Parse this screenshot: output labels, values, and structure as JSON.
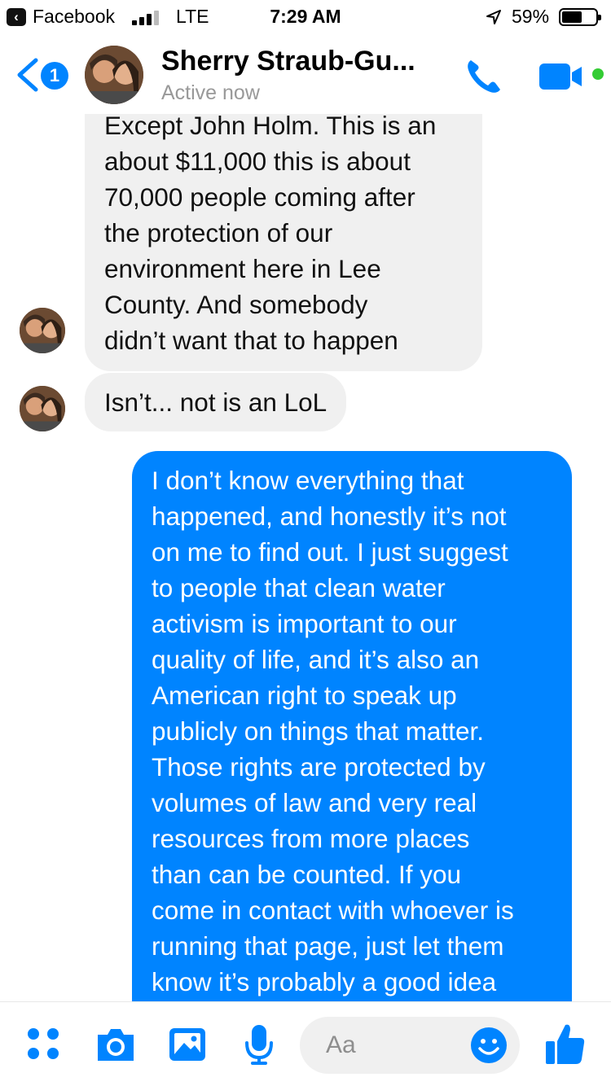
{
  "status_bar": {
    "back_app": "Facebook",
    "network": "LTE",
    "time": "7:29 AM",
    "battery": "59%",
    "battery_level": 0.59
  },
  "header": {
    "unread_count": "1",
    "name": "Sherry Straub-Gu...",
    "status": "Active now"
  },
  "messages": [
    {
      "sender": "contact",
      "text": "Except John Holm. This is an\nabout $11,000 this is about\n70,000 people coming after\nthe protection of our\nenvironment here in Lee\nCounty. And somebody\ndidn’t want that to happen"
    },
    {
      "sender": "contact",
      "text": "Isn’t... not is an LoL"
    },
    {
      "sender": "me",
      "text": "I don’t know everything that\nhappened, and honestly it’s not\non me to find out. I just suggest\nto people that clean water\nactivism is important to our\nquality of life, and it’s also an\nAmerican right to speak up\npublicly on things that matter.\nThose rights are protected by\nvolumes of law and very real\nresources from more places\nthan can be counted. If you\ncome in contact with whoever is\nrunning that page, just let them\nknow it’s probably a good idea"
    }
  ],
  "composer": {
    "placeholder": "Aa"
  },
  "colors": {
    "accent": "#0084ff",
    "incoming_bubble": "#f0f0f0",
    "active": "#33cc33"
  },
  "icons": [
    "back-chevron-icon",
    "signal-icon",
    "location-arrow-icon",
    "battery-icon",
    "phone-icon",
    "video-camera-icon",
    "apps-grid-icon",
    "camera-icon",
    "image-icon",
    "microphone-icon",
    "emoji-icon",
    "thumbs-up-icon"
  ]
}
